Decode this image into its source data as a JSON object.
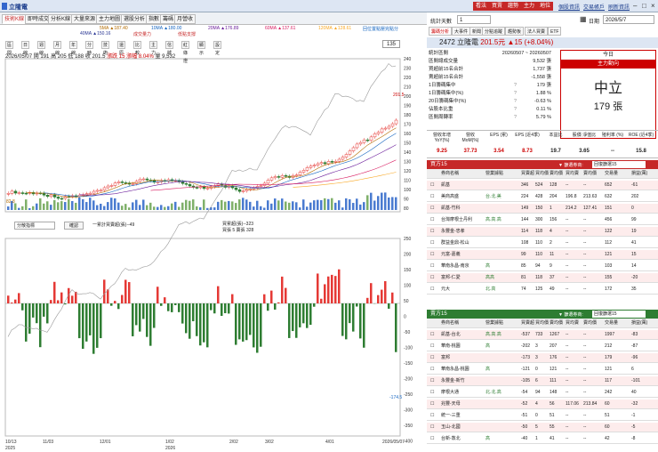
{
  "title": {
    "app": "立隆電",
    "buttons": [
      "看法",
      "買賣",
      "趨勢",
      "主力",
      "地位"
    ],
    "links": [
      "個股資訊",
      "交易帳戶",
      "刷新資訊"
    ]
  },
  "tabs": [
    "技術K線",
    "即時成交",
    "分析K線",
    "大量來源",
    "主力地圖",
    "選股分析",
    "指數",
    "籌碼",
    "月營收"
  ],
  "ma": [
    {
      "l": "5MA ▲187.40",
      "c": "#b36b00"
    },
    {
      "l": "10MA ▲180.00",
      "c": "#1565c0"
    },
    {
      "l": "20MA ▲176.89",
      "c": "#6a1b9a"
    },
    {
      "l": "60MA ▲137.61",
      "c": "#d81b60"
    },
    {
      "l": "120MA ▲128.61",
      "c": "#f9a825"
    },
    {
      "l": "40MA ▲150.16",
      "c": "#283593"
    },
    {
      "l": "成交量力",
      "c": "#c62828"
    },
    {
      "l": "低點支撐",
      "c": "#c62828"
    },
    {
      "l": "回位置點壓完點分",
      "c": "#1565c0"
    }
  ],
  "toolbar": [
    "區間",
    "日線",
    "週線",
    "月線",
    "年線",
    "分時",
    "技術",
    "還原",
    "比較",
    "主力",
    "信號",
    "紅綠燈",
    "顯示",
    "設定"
  ],
  "info": {
    "date": "2026/05/07",
    "o": "開 191",
    "h": "高 205",
    "l": "低 188",
    "c": "收 201.5",
    "chg": "漲跌 15",
    "pct": "漲幅 8.04%",
    "vol": "量 9,532",
    "qty": "135"
  },
  "y_axis": [
    "240",
    "230",
    "220",
    "210",
    "200",
    "190",
    "180",
    "170",
    "160",
    "150",
    "140",
    "130",
    "120",
    "110",
    "100",
    "90",
    "80"
  ],
  "price_left": "82.8",
  "price_last": "201.5",
  "ind": {
    "select": "分散指標",
    "btn": "確認",
    "t1": "一累計買賣超(張)--49",
    "t2": "買累超(張)--323",
    "t3": "買張 5 賣張 328",
    "last": "-174.5"
  },
  "ind_axis": [
    "250",
    "200",
    "150",
    "100",
    "50",
    "0",
    "-50",
    "-100",
    "-150",
    "-200",
    "-250",
    "-300",
    "-350",
    "-400"
  ],
  "x_axis": [
    "10/13",
    "11/03",
    "12/01",
    "1/02",
    "2/02",
    "3/02",
    "4/01",
    "2026/05/07"
  ],
  "x_years": [
    "2025",
    "2026"
  ],
  "right": {
    "range_lbl": "統計天數",
    "range": "1",
    "date_lbl": "日期",
    "date": "2026/5/7",
    "tabs": [
      "籌碼分析",
      "大事件",
      "新聞",
      "分點追蹤",
      "趨勢板",
      "法人買賣",
      "ETF"
    ],
    "stock": "2472 立隆電",
    "price": "201.5元",
    "chg": "▲15 (+8.04%)",
    "stats": [
      {
        "k": "統計區間",
        "v": "20260507 ~ 20260507"
      },
      {
        "k": "區間總成交量",
        "v": "9,532 張"
      },
      {
        "k": "買超前15名合計",
        "v": "1,737 張"
      },
      {
        "k": "賣超前15名合計",
        "v": "-1,558 張"
      },
      {
        "k": "1日籌碼集中",
        "v": "179 張",
        "q": "?"
      },
      {
        "k": "1日籌碼集中(%)",
        "v": "1.88 %",
        "q": "?"
      },
      {
        "k": "20日籌碼集中(%)",
        "v": "-0.63 %",
        "q": "?"
      },
      {
        "k": "佔股本比重",
        "v": "0.11 %",
        "q": "?"
      },
      {
        "k": "區間周轉率",
        "v": "5.79 %",
        "q": "?"
      }
    ],
    "dir": {
      "h1": "今日",
      "h2": "主力動向",
      "big": "中立",
      "cnt": "179 張"
    },
    "fin": [
      {
        "h": "營收年增 YoY(%)",
        "v": "9.25"
      },
      {
        "h": "營收 MoM(%)",
        "v": "37.73"
      },
      {
        "h": "EPS (累)",
        "v": "3.54"
      },
      {
        "h": "EPS (近4季)",
        "v": "8.73"
      },
      {
        "h": "本益比",
        "v": "19.7"
      },
      {
        "h": "股價 淨值比",
        "v": "3.65"
      },
      {
        "h": "殖利率 (%)",
        "v": "--"
      },
      {
        "h": "ROE (近4季)",
        "v": "15.8"
      }
    ],
    "buy": {
      "title": "買方15",
      "fm": "▼ 篩選券商:",
      "fsel": "回復篩選15",
      "cols": [
        "券商名稱",
        "營業據點",
        "買賣超",
        "買均價",
        "賣均價",
        "買均賣",
        "賣均價",
        "交易量",
        "損益(萬)"
      ],
      "rows": [
        [
          "凱基",
          "",
          "346",
          "524",
          "128",
          "--",
          "--",
          "652",
          "-61"
        ],
        [
          "美商高盛",
          "台.北.美",
          "224",
          "428",
          "204",
          "196.8",
          "213.63",
          "632",
          "202"
        ],
        [
          "凱基-竹科",
          "",
          "149",
          "150",
          "1",
          "214.2",
          "127.41",
          "151",
          "0"
        ],
        [
          "台灣摩根士丹利",
          "高.高.高",
          "144",
          "300",
          "156",
          "--",
          "--",
          "456",
          "99"
        ],
        [
          "永豐金-忠孝",
          "",
          "114",
          "118",
          "4",
          "--",
          "--",
          "122",
          "19"
        ],
        [
          "群益金鼎-松山",
          "",
          "108",
          "110",
          "2",
          "--",
          "--",
          "112",
          "41"
        ],
        [
          "元富-嘉義",
          "",
          "99",
          "110",
          "11",
          "--",
          "--",
          "121",
          "15"
        ],
        [
          "華南永昌-南京",
          "高",
          "85",
          "94",
          "9",
          "--",
          "--",
          "103",
          "14"
        ],
        [
          "富邦-仁愛",
          "高高",
          "81",
          "118",
          "37",
          "--",
          "--",
          "155",
          "-20"
        ],
        [
          "元大",
          "北.高",
          "74",
          "125",
          "49",
          "--",
          "--",
          "172",
          "35"
        ]
      ]
    },
    "sell": {
      "title": "賣方15",
      "fm": "▼ 篩選券商:",
      "fsel": "回復篩選15",
      "cols": [
        "券商名稱",
        "營業據點",
        "買賣超",
        "買均價",
        "賣均價",
        "買均賣",
        "賣均價",
        "交易量",
        "損益(萬)"
      ],
      "rows": [
        [
          "凱基-台北",
          "高.高.高",
          "-537",
          "733",
          "1267",
          "--",
          "--",
          "1997",
          "-83"
        ],
        [
          "華南-桃園",
          "高",
          "-202",
          "3",
          "207",
          "--",
          "--",
          "212",
          "-87"
        ],
        [
          "富邦",
          "",
          "-173",
          "3",
          "176",
          "--",
          "--",
          "179",
          "-96"
        ],
        [
          "華南永昌-桃園",
          "高",
          "-121",
          "0",
          "121",
          "--",
          "--",
          "121",
          "6"
        ],
        [
          "永豐金-新竹",
          "",
          "-105",
          "6",
          "111",
          "--",
          "--",
          "117",
          "-101"
        ],
        [
          "摩根大通",
          "北.北.高",
          "-54",
          "94",
          "148",
          "--",
          "--",
          "242",
          "40"
        ],
        [
          "兆豐-天母",
          "",
          "-52",
          "4",
          "56",
          "117.06",
          "213.84",
          "60",
          "-32"
        ],
        [
          "統一-三重",
          "",
          "-51",
          "0",
          "51",
          "--",
          "--",
          "51",
          "-1"
        ],
        [
          "玉山-北國",
          "",
          "-50",
          "5",
          "55",
          "--",
          "--",
          "60",
          "-5"
        ],
        [
          "台新-敦北",
          "高",
          "-40",
          "1",
          "41",
          "--",
          "--",
          "42",
          "-8"
        ]
      ]
    }
  },
  "colors": {
    "up": "#e53935",
    "down": "#2e7d32",
    "buyhead": "#c62828",
    "sellhead": "#2e7d32"
  }
}
